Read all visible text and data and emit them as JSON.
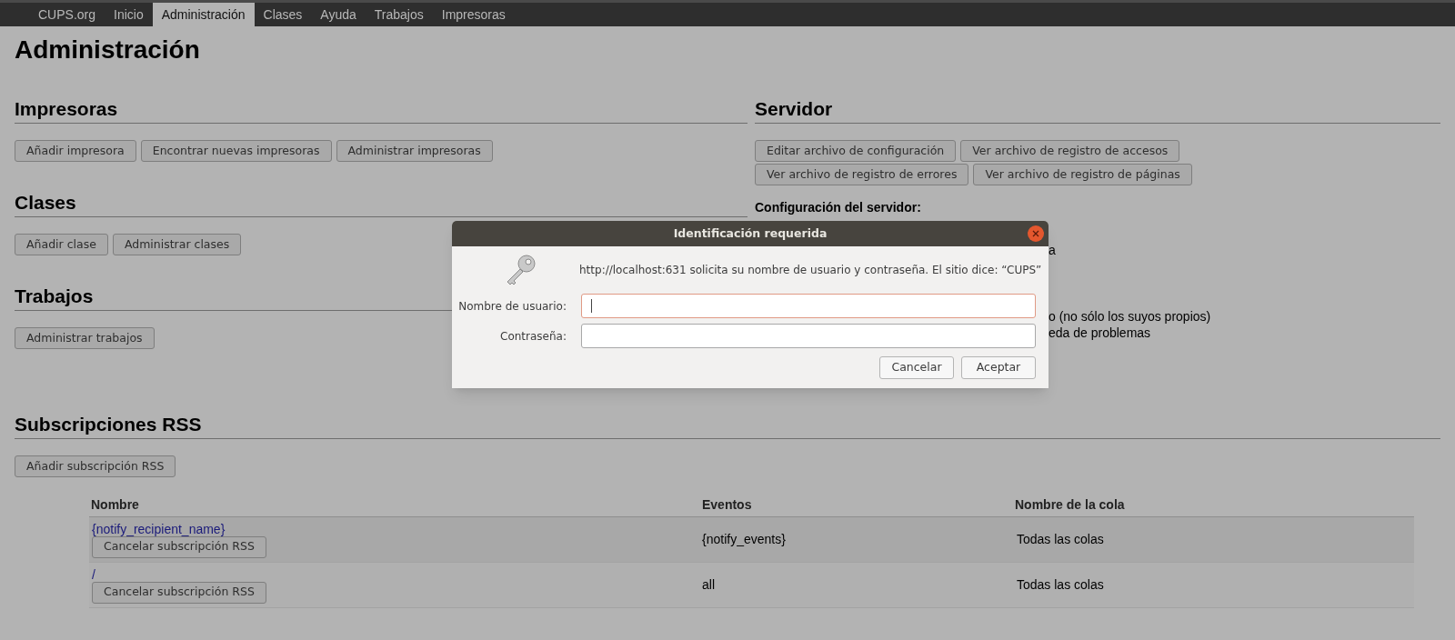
{
  "nav": [
    {
      "label": "CUPS.org",
      "selected": false
    },
    {
      "label": "Inicio",
      "selected": false
    },
    {
      "label": "Administración",
      "selected": true
    },
    {
      "label": "Clases",
      "selected": false
    },
    {
      "label": "Ayuda",
      "selected": false
    },
    {
      "label": "Trabajos",
      "selected": false
    },
    {
      "label": "Impresoras",
      "selected": false
    }
  ],
  "title": "Administración",
  "sections": [
    {
      "title": "Impresoras",
      "buttons": [
        "Añadir impresora",
        "Encontrar nuevas impresoras",
        "Administrar impresoras"
      ]
    },
    {
      "title": "Clases",
      "buttons": [
        "Añadir clase",
        "Administrar clases"
      ]
    },
    {
      "title": "Trabajos",
      "buttons": [
        "Administrar trabajos"
      ]
    }
  ],
  "server": {
    "title": "Servidor",
    "buttons": [
      "Editar archivo de configuración",
      "Ver archivo de registro de accesos",
      "Ver archivo de registro de errores",
      "Ver archivo de registro de páginas"
    ],
    "settings_heading": "Configuración del servidor:",
    "partly_hidden_settings": [
      "a",
      "o (no sólo los suyos propios)",
      "eda de problemas"
    ]
  },
  "rss": {
    "title": "Subscripciones RSS",
    "button": "Añadir subscripción RSS",
    "columns": [
      "Nombre",
      "Eventos",
      "Nombre de la cola"
    ],
    "rows": [
      {
        "name": "{notify_recipient_name}",
        "action": "Cancelar subscripción RSS",
        "events": "{notify_events}",
        "queue": "Todas las colas"
      },
      {
        "name": "/",
        "action": "Cancelar subscripción RSS",
        "events": "all",
        "queue": "Todas las colas"
      }
    ]
  },
  "dialog": {
    "title": "Identificación requerida",
    "message": "http://localhost:631 solicita su nombre de usuario y contraseña. El sitio dice: “CUPS”",
    "fields": [
      {
        "label": "Nombre de usuario:",
        "focused": true
      },
      {
        "label": "Contraseña:",
        "focused": false
      }
    ],
    "buttons": [
      "Cancelar",
      "Aceptar"
    ]
  }
}
